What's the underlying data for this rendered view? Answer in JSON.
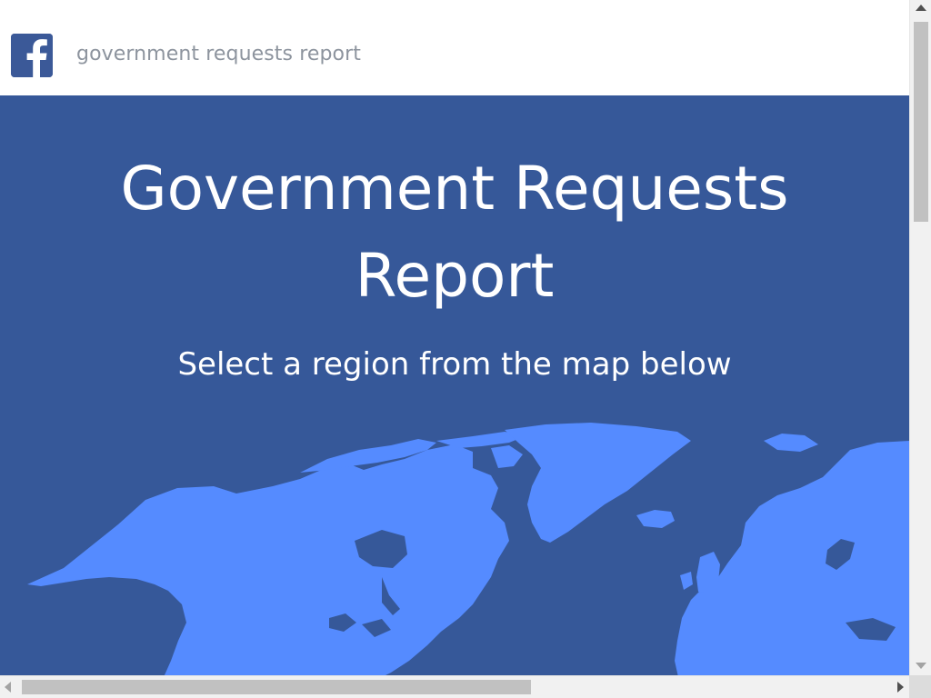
{
  "header": {
    "brand_text": "government requests report",
    "logo_icon": "facebook-logo-icon",
    "logo_color": "#3b5998"
  },
  "hero": {
    "title_line1": "Government Requests",
    "title_line2": "Report",
    "subtitle": "Select a region from the map below",
    "background_color": "#365899",
    "map_land_color": "#558bff"
  },
  "scrollbars": {
    "vertical": "vertical-scrollbar",
    "horizontal": "horizontal-scrollbar"
  }
}
